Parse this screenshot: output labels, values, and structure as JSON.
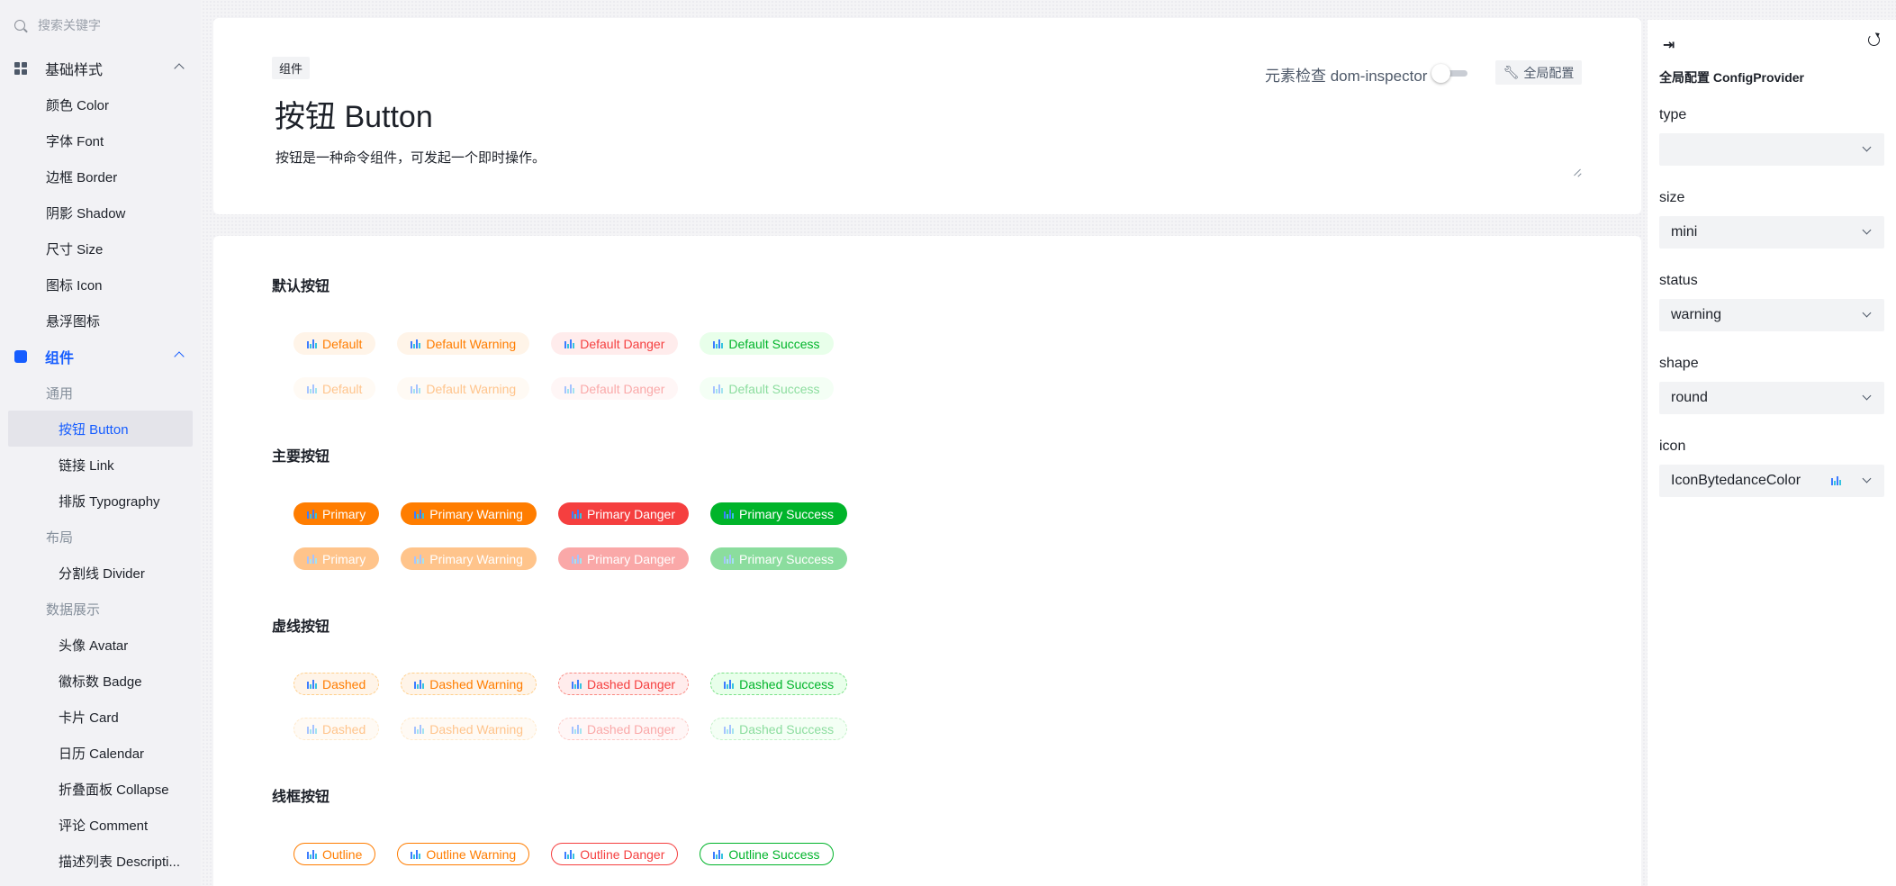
{
  "sidebar": {
    "search_placeholder": "搜索关键字",
    "groups": [
      {
        "label": "基础样式",
        "items": [
          "颜色 Color",
          "字体 Font",
          "边框 Border",
          "阴影 Shadow",
          "尺寸 Size",
          "图标 Icon",
          "悬浮图标"
        ]
      },
      {
        "label": "组件",
        "categories": [
          {
            "label": "通用",
            "items": [
              "按钮 Button",
              "链接 Link",
              "排版 Typography"
            ]
          },
          {
            "label": "布局",
            "items": [
              "分割线 Divider"
            ]
          },
          {
            "label": "数据展示",
            "items": [
              "头像 Avatar",
              "徽标数 Badge",
              "卡片 Card",
              "日历 Calendar",
              "折叠面板 Collapse",
              "评论 Comment",
              "描述列表 Descripti..."
            ]
          }
        ]
      }
    ],
    "selected_item": "按钮 Button"
  },
  "header": {
    "tag": "组件",
    "title": "按钮 Button",
    "description": "按钮是一种命令组件，可发起一个即时操作。",
    "inspector_label": "元素检查 dom-inspector",
    "inspector_on": false,
    "global_config_label": "全局配置"
  },
  "sections": [
    {
      "title": "默认按钮",
      "rows": [
        [
          "Default",
          "Default Warning",
          "Default Danger",
          "Default Success"
        ],
        [
          "Default",
          "Default Warning",
          "Default Danger",
          "Default Success"
        ]
      ]
    },
    {
      "title": "主要按钮",
      "rows": [
        [
          "Primary",
          "Primary Warning",
          "Primary Danger",
          "Primary Success"
        ],
        [
          "Primary",
          "Primary Warning",
          "Primary Danger",
          "Primary Success"
        ]
      ]
    },
    {
      "title": "虚线按钮",
      "rows": [
        [
          "Dashed",
          "Dashed Warning",
          "Dashed Danger",
          "Dashed Success"
        ],
        [
          "Dashed",
          "Dashed Warning",
          "Dashed Danger",
          "Dashed Success"
        ]
      ]
    },
    {
      "title": "线框按钮",
      "rows": [
        [
          "Outline",
          "Outline Warning",
          "Outline Danger",
          "Outline Success"
        ]
      ]
    }
  ],
  "config_panel": {
    "title": "全局配置 ConfigProvider",
    "fields": [
      {
        "label": "type",
        "value": ""
      },
      {
        "label": "size",
        "value": "mini"
      },
      {
        "label": "status",
        "value": "warning"
      },
      {
        "label": "shape",
        "value": "round"
      },
      {
        "label": "icon",
        "value": "IconBytedanceColor"
      }
    ]
  },
  "colors": {
    "accent": "#165dff",
    "warning": "#ff7d00",
    "danger": "#f53f3f",
    "success": "#00b42a"
  },
  "icons": {
    "button_icon": "bytedance-color-icon",
    "search": "search-icon",
    "collapse": "collapse-panel-icon",
    "refresh": "refresh-icon"
  }
}
